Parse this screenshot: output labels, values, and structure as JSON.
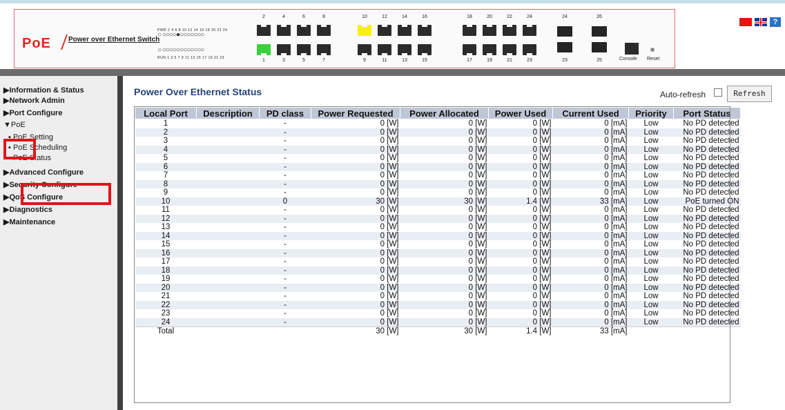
{
  "device": {
    "brand": "PoE",
    "subtitle": "Power over Ethernet Switch",
    "led_pwr": "PWR 2 4 6 8 10 12 14 16 18 20 22 24",
    "led_run": "RUN 1 3 5 7 9 11 13 15 17 19 21 23",
    "led_row_top": "○ ○○○○●○○○○○○○",
    "led_row_bottom": "○ ○○○○○○○○○○○○",
    "ports_top": [
      "2",
      "4",
      "6",
      "8",
      "10",
      "12",
      "14",
      "16",
      "18",
      "20",
      "22",
      "24"
    ],
    "ports_bottom": [
      "1",
      "3",
      "5",
      "7",
      "9",
      "11",
      "13",
      "15",
      "17",
      "19",
      "21",
      "23"
    ],
    "sfp_top": [
      "24",
      "26"
    ],
    "sfp_bottom": [
      "23",
      "25"
    ],
    "console_label": "Console",
    "reset_label": "Reset"
  },
  "sidebar": {
    "menu": [
      {
        "label": "▶Information & Status"
      },
      {
        "label": "▶Network Admin"
      },
      {
        "label": "▶Port Configure"
      },
      {
        "label": "▼PoE"
      }
    ],
    "poe_sub": [
      {
        "label": "▪ PoE Setting"
      },
      {
        "label": "▪ PoE Scheduling"
      },
      {
        "label": "▪ PoE Status"
      }
    ],
    "menu2": [
      {
        "label": "▶Advanced Configure"
      },
      {
        "label": "▶Security Configure"
      },
      {
        "label": "▶QoS Configure"
      },
      {
        "label": "▶Diagnostics"
      },
      {
        "label": "▶Maintenance"
      }
    ]
  },
  "page": {
    "title": "Power Over Ethernet Status",
    "autorefresh_label": "Auto-refresh",
    "refresh_button": "Refresh"
  },
  "table": {
    "headers": [
      "Local Port",
      "Description",
      "PD class",
      "Power Requested",
      "Power Allocated",
      "Power Used",
      "Current Used",
      "Priority",
      "Port Status"
    ],
    "rows": [
      [
        "1",
        "",
        "-",
        "0 [W]",
        "0 [W]",
        "0 [W]",
        "0 [mA]",
        "Low",
        "No PD detected"
      ],
      [
        "2",
        "",
        "-",
        "0 [W]",
        "0 [W]",
        "0 [W]",
        "0 [mA]",
        "Low",
        "No PD detected"
      ],
      [
        "3",
        "",
        "-",
        "0 [W]",
        "0 [W]",
        "0 [W]",
        "0 [mA]",
        "Low",
        "No PD detected"
      ],
      [
        "4",
        "",
        "-",
        "0 [W]",
        "0 [W]",
        "0 [W]",
        "0 [mA]",
        "Low",
        "No PD detected"
      ],
      [
        "5",
        "",
        "-",
        "0 [W]",
        "0 [W]",
        "0 [W]",
        "0 [mA]",
        "Low",
        "No PD detected"
      ],
      [
        "6",
        "",
        "-",
        "0 [W]",
        "0 [W]",
        "0 [W]",
        "0 [mA]",
        "Low",
        "No PD detected"
      ],
      [
        "7",
        "",
        "-",
        "0 [W]",
        "0 [W]",
        "0 [W]",
        "0 [mA]",
        "Low",
        "No PD detected"
      ],
      [
        "8",
        "",
        "-",
        "0 [W]",
        "0 [W]",
        "0 [W]",
        "0 [mA]",
        "Low",
        "No PD detected"
      ],
      [
        "9",
        "",
        "-",
        "0 [W]",
        "0 [W]",
        "0 [W]",
        "0 [mA]",
        "Low",
        "No PD detected"
      ],
      [
        "10",
        "",
        "0",
        "30 [W]",
        "30 [W]",
        "1.4 [W]",
        "33 [mA]",
        "Low",
        "PoE turned ON"
      ],
      [
        "11",
        "",
        "-",
        "0 [W]",
        "0 [W]",
        "0 [W]",
        "0 [mA]",
        "Low",
        "No PD detected"
      ],
      [
        "12",
        "",
        "-",
        "0 [W]",
        "0 [W]",
        "0 [W]",
        "0 [mA]",
        "Low",
        "No PD detected"
      ],
      [
        "13",
        "",
        "-",
        "0 [W]",
        "0 [W]",
        "0 [W]",
        "0 [mA]",
        "Low",
        "No PD detected"
      ],
      [
        "14",
        "",
        "-",
        "0 [W]",
        "0 [W]",
        "0 [W]",
        "0 [mA]",
        "Low",
        "No PD detected"
      ],
      [
        "15",
        "",
        "-",
        "0 [W]",
        "0 [W]",
        "0 [W]",
        "0 [mA]",
        "Low",
        "No PD detected"
      ],
      [
        "16",
        "",
        "-",
        "0 [W]",
        "0 [W]",
        "0 [W]",
        "0 [mA]",
        "Low",
        "No PD detected"
      ],
      [
        "17",
        "",
        "-",
        "0 [W]",
        "0 [W]",
        "0 [W]",
        "0 [mA]",
        "Low",
        "No PD detected"
      ],
      [
        "18",
        "",
        "-",
        "0 [W]",
        "0 [W]",
        "0 [W]",
        "0 [mA]",
        "Low",
        "No PD detected"
      ],
      [
        "19",
        "",
        "-",
        "0 [W]",
        "0 [W]",
        "0 [W]",
        "0 [mA]",
        "Low",
        "No PD detected"
      ],
      [
        "20",
        "",
        "-",
        "0 [W]",
        "0 [W]",
        "0 [W]",
        "0 [mA]",
        "Low",
        "No PD detected"
      ],
      [
        "21",
        "",
        "-",
        "0 [W]",
        "0 [W]",
        "0 [W]",
        "0 [mA]",
        "Low",
        "No PD detected"
      ],
      [
        "22",
        "",
        "-",
        "0 [W]",
        "0 [W]",
        "0 [W]",
        "0 [mA]",
        "Low",
        "No PD detected"
      ],
      [
        "23",
        "",
        "-",
        "0 [W]",
        "0 [W]",
        "0 [W]",
        "0 [mA]",
        "Low",
        "No PD detected"
      ],
      [
        "24",
        "",
        "-",
        "0 [W]",
        "0 [W]",
        "0 [W]",
        "0 [mA]",
        "Low",
        "No PD detected"
      ]
    ],
    "total": [
      "Total",
      "",
      "",
      "30 [W]",
      "30 [W]",
      "1.4 [W]",
      "33 [mA]",
      "",
      ""
    ]
  },
  "colors": {
    "title": "#24437a",
    "header_bg": "#bfc7d7",
    "row_alt": "#e9edf4",
    "highlight_box": "#e0141a",
    "port_active_yellow": "#f7f20b",
    "port_active_green": "#39d13c"
  },
  "icons": {
    "flag_cn": "china-flag-icon",
    "flag_uk": "uk-flag-icon",
    "help": "help-icon"
  }
}
